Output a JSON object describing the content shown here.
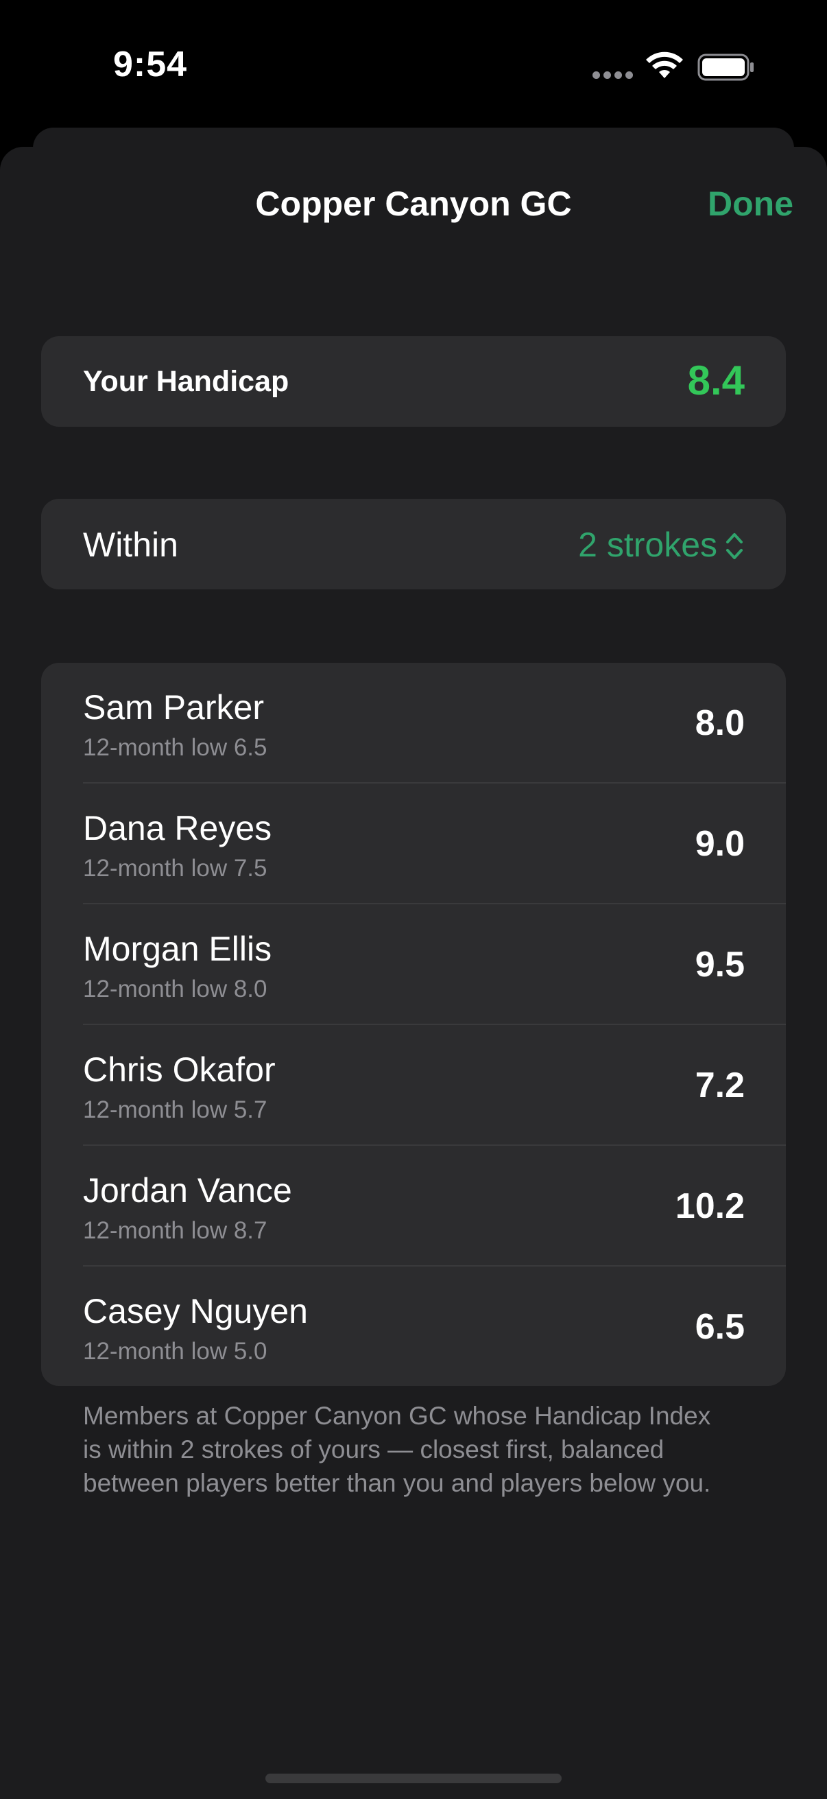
{
  "status_bar": {
    "time": "9:54"
  },
  "header": {
    "title": "Copper Canyon GC",
    "done_label": "Done"
  },
  "handicap": {
    "label": "Your Handicap",
    "value": "8.4"
  },
  "within": {
    "label": "Within",
    "value": "2 strokes"
  },
  "members": [
    {
      "name": "Sam Parker",
      "low": "12-month low 6.5",
      "index": "8.0"
    },
    {
      "name": "Dana Reyes",
      "low": "12-month low 7.5",
      "index": "9.0"
    },
    {
      "name": "Morgan Ellis",
      "low": "12-month low 8.0",
      "index": "9.5"
    },
    {
      "name": "Chris Okafor",
      "low": "12-month low 5.7",
      "index": "7.2"
    },
    {
      "name": "Jordan Vance",
      "low": "12-month low 8.7",
      "index": "10.2"
    },
    {
      "name": "Casey Nguyen",
      "low": "12-month low 5.0",
      "index": "6.5"
    }
  ],
  "footnote": "Members at Copper Canyon GC whose Handicap Index is within 2 strokes of yours — closest first, balanced between players better than you and players below you.",
  "icons": {
    "wifi": "wifi-icon",
    "battery": "battery-icon",
    "signal": "signal-dots-icon",
    "picker": "chevron-up-down-icon"
  },
  "colors": {
    "accent": "#30a46c",
    "handicap_value": "#33c759",
    "sheet_background": "#1c1c1e",
    "card_background": "#2c2c2e",
    "secondary_text": "#8e8e93"
  }
}
